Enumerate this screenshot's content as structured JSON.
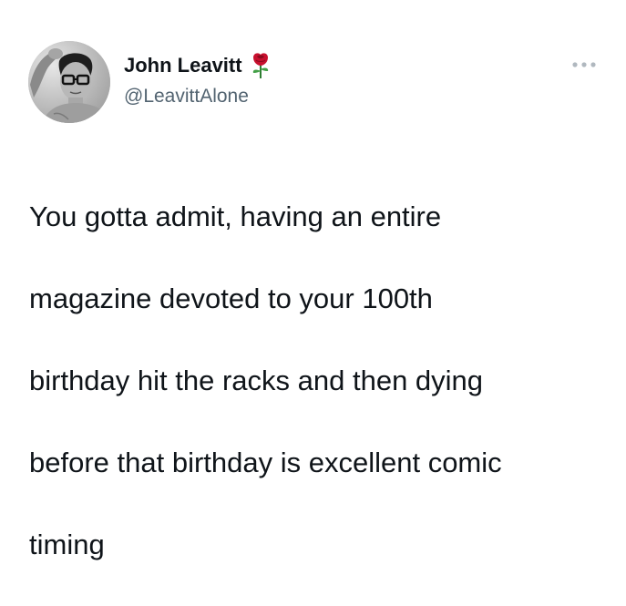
{
  "author": {
    "display_name": "John Leavitt",
    "name_emoji_icon": "rose-icon",
    "handle": "@LeavittAlone",
    "avatar_icon": "profile-photo"
  },
  "menu": {
    "more_icon": "more-options-icon"
  },
  "tweet": {
    "text_lines": [
      "You gotta admit, having an entire",
      "magazine devoted to your 100th",
      "birthday hit the racks and then dying",
      "before that birthday is excellent comic",
      "timing"
    ]
  },
  "colors": {
    "text_primary": "#0f1419",
    "text_secondary": "#536471",
    "more_dots": "#b0b8bf",
    "rose": "#c8102e"
  }
}
